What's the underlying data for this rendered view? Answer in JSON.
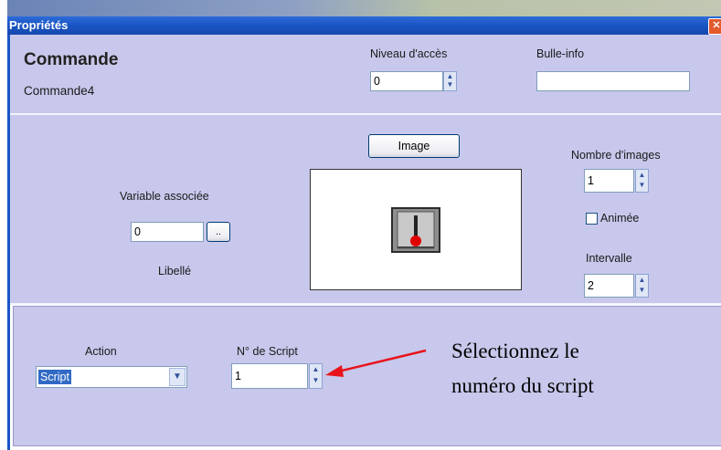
{
  "window": {
    "title": "Propriétés",
    "close_symbol": "✕"
  },
  "command": {
    "heading": "Commande",
    "name": "Commande4"
  },
  "access": {
    "label": "Niveau d'accès",
    "value": "0"
  },
  "tooltip": {
    "label": "Bulle-info",
    "value": ""
  },
  "variable": {
    "label": "Variable associée",
    "value": "0",
    "browse_label": "..",
    "libelle_label": "Libellé"
  },
  "image": {
    "button_label": "Image",
    "preview_icon": "toggle-switch-icon"
  },
  "images_count": {
    "label": "Nombre d'images",
    "value": "1"
  },
  "animated": {
    "label": "Animée",
    "checked": false
  },
  "interval": {
    "label": "Intervalle",
    "value": "2"
  },
  "action": {
    "label": "Action",
    "value": "Script"
  },
  "script": {
    "label": "N° de Script",
    "value": "1"
  },
  "annotation": {
    "line1": "Sélectionnez le",
    "line2": "numéro du script",
    "arrow_color": "#e8141b"
  },
  "colors": {
    "panel_bg": "#c8c8ec",
    "title_bar": "#1a55c4"
  }
}
